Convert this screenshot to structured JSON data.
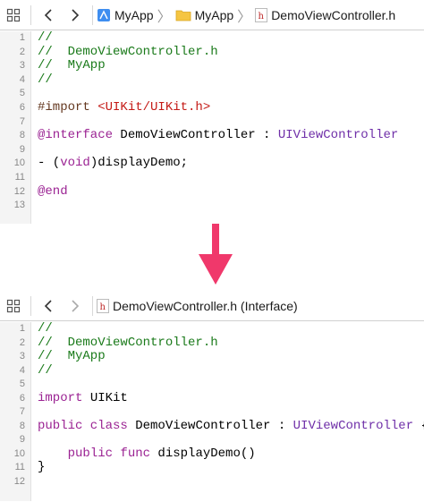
{
  "top": {
    "crumbs": [
      {
        "label": "MyApp",
        "icon": "xcode-project-icon"
      },
      {
        "label": "MyApp",
        "icon": "folder-icon"
      },
      {
        "label": "DemoViewController.h",
        "icon": "header-file-icon"
      }
    ],
    "lines": [
      {
        "n": "1",
        "parts": [
          {
            "c": "c",
            "t": "//"
          }
        ]
      },
      {
        "n": "2",
        "parts": [
          {
            "c": "c",
            "t": "//  DemoViewController.h"
          }
        ]
      },
      {
        "n": "3",
        "parts": [
          {
            "c": "c",
            "t": "//  MyApp"
          }
        ]
      },
      {
        "n": "4",
        "parts": [
          {
            "c": "c",
            "t": "//"
          }
        ]
      },
      {
        "n": "5",
        "parts": []
      },
      {
        "n": "6",
        "parts": [
          {
            "c": "p",
            "t": "#import "
          },
          {
            "c": "s",
            "t": "<UIKit/UIKit.h>"
          }
        ]
      },
      {
        "n": "7",
        "parts": []
      },
      {
        "n": "8",
        "parts": [
          {
            "c": "k",
            "t": "@interface"
          },
          {
            "c": "plain",
            "t": " DemoViewController : "
          },
          {
            "c": "t",
            "t": "UIViewController"
          }
        ]
      },
      {
        "n": "9",
        "parts": []
      },
      {
        "n": "10",
        "parts": [
          {
            "c": "plain",
            "t": "- ("
          },
          {
            "c": "k",
            "t": "void"
          },
          {
            "c": "plain",
            "t": ")displayDemo;"
          }
        ]
      },
      {
        "n": "11",
        "parts": []
      },
      {
        "n": "12",
        "parts": [
          {
            "c": "k",
            "t": "@end"
          }
        ]
      },
      {
        "n": "13",
        "parts": []
      }
    ]
  },
  "bottom": {
    "crumbs": [
      {
        "label": "DemoViewController.h (Interface)",
        "icon": "header-file-icon"
      }
    ],
    "lines": [
      {
        "n": "1",
        "parts": [
          {
            "c": "c",
            "t": "//"
          }
        ]
      },
      {
        "n": "2",
        "parts": [
          {
            "c": "c",
            "t": "//  DemoViewController.h"
          }
        ]
      },
      {
        "n": "3",
        "parts": [
          {
            "c": "c",
            "t": "//  MyApp"
          }
        ]
      },
      {
        "n": "4",
        "parts": [
          {
            "c": "c",
            "t": "//"
          }
        ]
      },
      {
        "n": "5",
        "parts": []
      },
      {
        "n": "6",
        "parts": [
          {
            "c": "k",
            "t": "import"
          },
          {
            "c": "plain",
            "t": " UIKit"
          }
        ]
      },
      {
        "n": "7",
        "parts": []
      },
      {
        "n": "8",
        "parts": [
          {
            "c": "k",
            "t": "public class"
          },
          {
            "c": "plain",
            "t": " DemoViewController : "
          },
          {
            "c": "t",
            "t": "UIViewController"
          },
          {
            "c": "plain",
            "t": " {"
          }
        ]
      },
      {
        "n": "9",
        "parts": []
      },
      {
        "n": "10",
        "parts": [
          {
            "c": "plain",
            "t": "    "
          },
          {
            "c": "k",
            "t": "public func"
          },
          {
            "c": "plain",
            "t": " displayDemo()"
          }
        ]
      },
      {
        "n": "11",
        "parts": [
          {
            "c": "plain",
            "t": "}"
          }
        ]
      },
      {
        "n": "12",
        "parts": []
      }
    ]
  },
  "colors": {
    "arrow": "#f0386b",
    "comment": "#1a7a1a",
    "keyword": "#9b2393",
    "string": "#c41a16",
    "type": "#6f2fa8"
  }
}
